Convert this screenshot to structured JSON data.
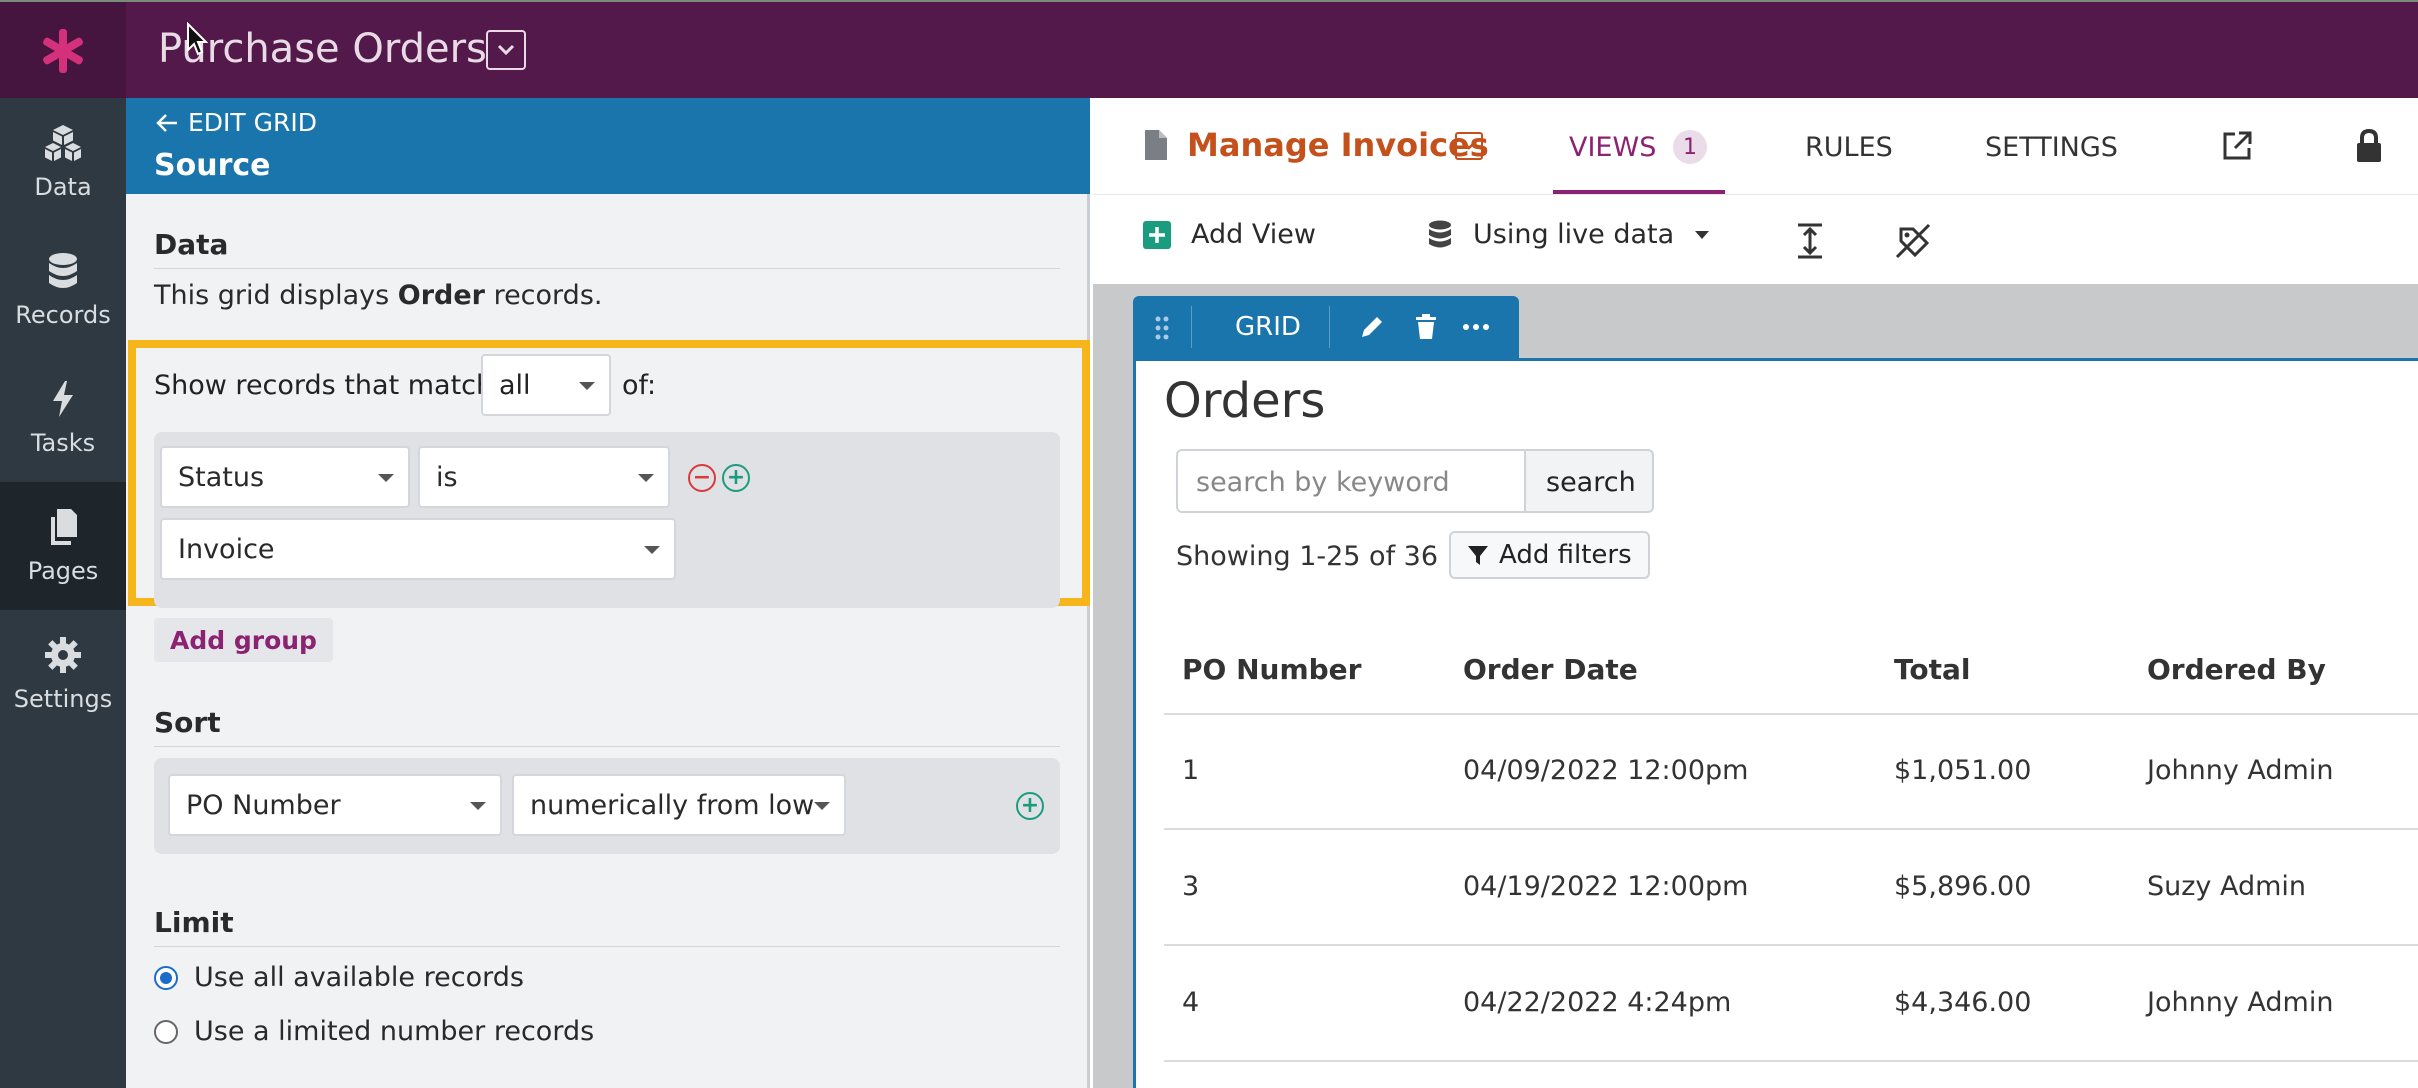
{
  "topbar": {
    "title": "Purchase Orders"
  },
  "nav": {
    "items": [
      {
        "label": "Data",
        "icon": "cubes-icon"
      },
      {
        "label": "Records",
        "icon": "database-icon"
      },
      {
        "label": "Tasks",
        "icon": "bolt-icon"
      },
      {
        "label": "Pages",
        "icon": "pages-icon",
        "active": true
      },
      {
        "label": "Settings",
        "icon": "gear-icon"
      }
    ]
  },
  "editor": {
    "back_label": "EDIT GRID",
    "subtitle": "Source",
    "data_title": "Data",
    "desc_prefix": "This grid displays ",
    "desc_object": "Order",
    "desc_suffix": " records.",
    "match_label": "Show records that match",
    "match_value": "all",
    "match_suffix": "of:",
    "condition": {
      "field": "Status",
      "operator": "is",
      "value": "Invoice"
    },
    "add_group": "Add group",
    "sort_title": "Sort",
    "sort_field": "PO Number",
    "sort_order": "numerically from low",
    "limit_title": "Limit",
    "limit_opt1": "Use all available records",
    "limit_opt2": "Use a limited number records"
  },
  "page": {
    "title": "Manage Invoices",
    "tabs": {
      "views": "VIEWS",
      "views_count": "1",
      "rules": "RULES",
      "settings": "SETTINGS"
    },
    "add_view": "Add View",
    "data_mode": "Using live data"
  },
  "grid": {
    "tab_label": "GRID",
    "title": "Orders",
    "search_placeholder": "search by keyword",
    "search_button": "search",
    "showing": "Showing 1-25 of 36",
    "add_filters": "Add filters",
    "columns": [
      "PO Number",
      "Order Date",
      "Total",
      "Ordered By"
    ],
    "rows": [
      [
        "1",
        "04/09/2022 12:00pm",
        "$1,051.00",
        "Johnny Admin"
      ],
      [
        "3",
        "04/19/2022 12:00pm",
        "$5,896.00",
        "Suzy Admin"
      ],
      [
        "4",
        "04/22/2022 4:24pm",
        "$4,346.00",
        "Johnny Admin"
      ]
    ]
  },
  "colors": {
    "topbar": "#53194b",
    "nav": "#2e3941",
    "editor_head": "#1a75ad",
    "highlight": "#f5b51b",
    "accent": "#8b2372",
    "page_title": "#c4501b"
  }
}
